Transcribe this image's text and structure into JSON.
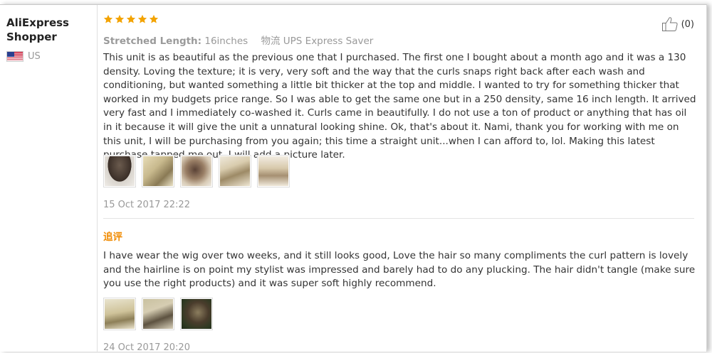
{
  "reviewer": {
    "name": "AliExpress Shopper",
    "country": "US"
  },
  "review": {
    "rating": 5,
    "rating_max": 5,
    "star_color": "#f3a300",
    "attributes": {
      "label": "Stretched Length:",
      "value": "16inches",
      "shipping": "物流 UPS Express Saver"
    },
    "helpful_count": "(0)",
    "text": "This unit is as beautiful as the previous one that I purchased. The first one I bought about a month ago and it was a 130 density. Loving the texture; it is very, very soft and the way that the curls snaps right back after each wash and conditioning, but wanted something a little bit thicker at the top and middle. I wanted to try for something thicker that worked in my budgets price range. So I was able to get the same one but in a 250 density, same 16 inch length. It arrived very fast and I immediately co-washed it. Curls came in beautifully. I do not use a ton of product or anything that has oil in it because it will give the unit a unnatural looking shine. Ok, that's about it. Nami, thank you for working with me on this unit, I will be purchasing from you again; this time a straight unit...when I can afford to, lol. Making this latest purchase tapped me out. I will add a picture later.",
    "photo_count": 5,
    "date": "15 Oct 2017 22:22"
  },
  "additional_review": {
    "label": "追评",
    "label_color": "#f08a00",
    "text": "I have wear the wig over two weeks, and it still looks good, Love the hair so many compliments the curl pattern is lovely and the hairline is on point my stylist was impressed and barely had to do any plucking. The hair didn't tangle (make sure you use the right products) and it was super soft highly recommend.",
    "photo_count": 3,
    "date": "24 Oct 2017 20:20"
  }
}
